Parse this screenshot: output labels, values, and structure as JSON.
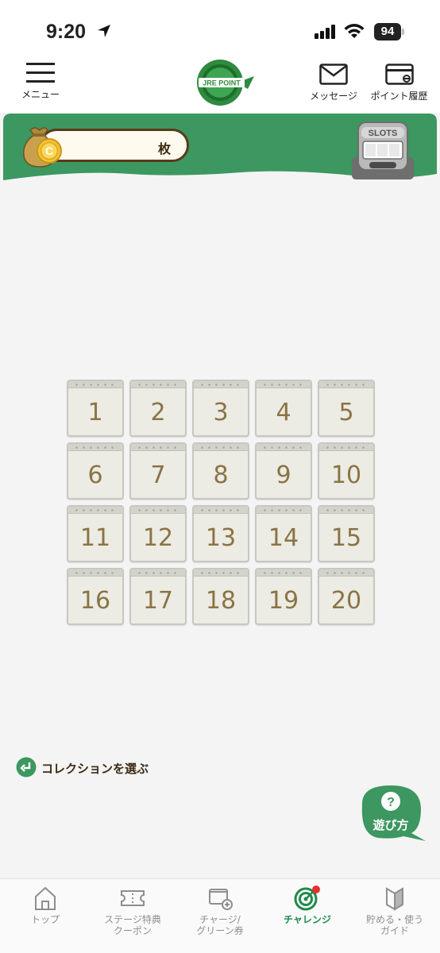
{
  "status_bar": {
    "time": "9:20",
    "battery": "94"
  },
  "header": {
    "menu_label": "メニュー",
    "logo_text": "JRE POINT",
    "message_label": "メッセージ",
    "point_history_label": "ポイント履歴"
  },
  "coin": {
    "count": "",
    "unit": "枚"
  },
  "slots": {
    "label": "SLOTS"
  },
  "grid": {
    "items": [
      "1",
      "2",
      "3",
      "4",
      "5",
      "6",
      "7",
      "8",
      "9",
      "10",
      "11",
      "12",
      "13",
      "14",
      "15",
      "16",
      "17",
      "18",
      "19",
      "20"
    ]
  },
  "collection": {
    "label": "コレクションを選ぶ"
  },
  "help": {
    "label": "遊び方"
  },
  "tabs": [
    {
      "label": "トップ",
      "icon": "home-icon"
    },
    {
      "label": "ステージ特典\nクーポン",
      "icon": "ticket-icon"
    },
    {
      "label": "チャージ/\nグリーン券",
      "icon": "charge-icon"
    },
    {
      "label": "チャレンジ",
      "icon": "target-icon",
      "active": true
    },
    {
      "label": "貯める・使う\nガイド",
      "icon": "guide-icon"
    }
  ],
  "colors": {
    "brand_green": "#3c9760",
    "active_tab": "#1f8a4a",
    "number_color": "#8a7444"
  }
}
